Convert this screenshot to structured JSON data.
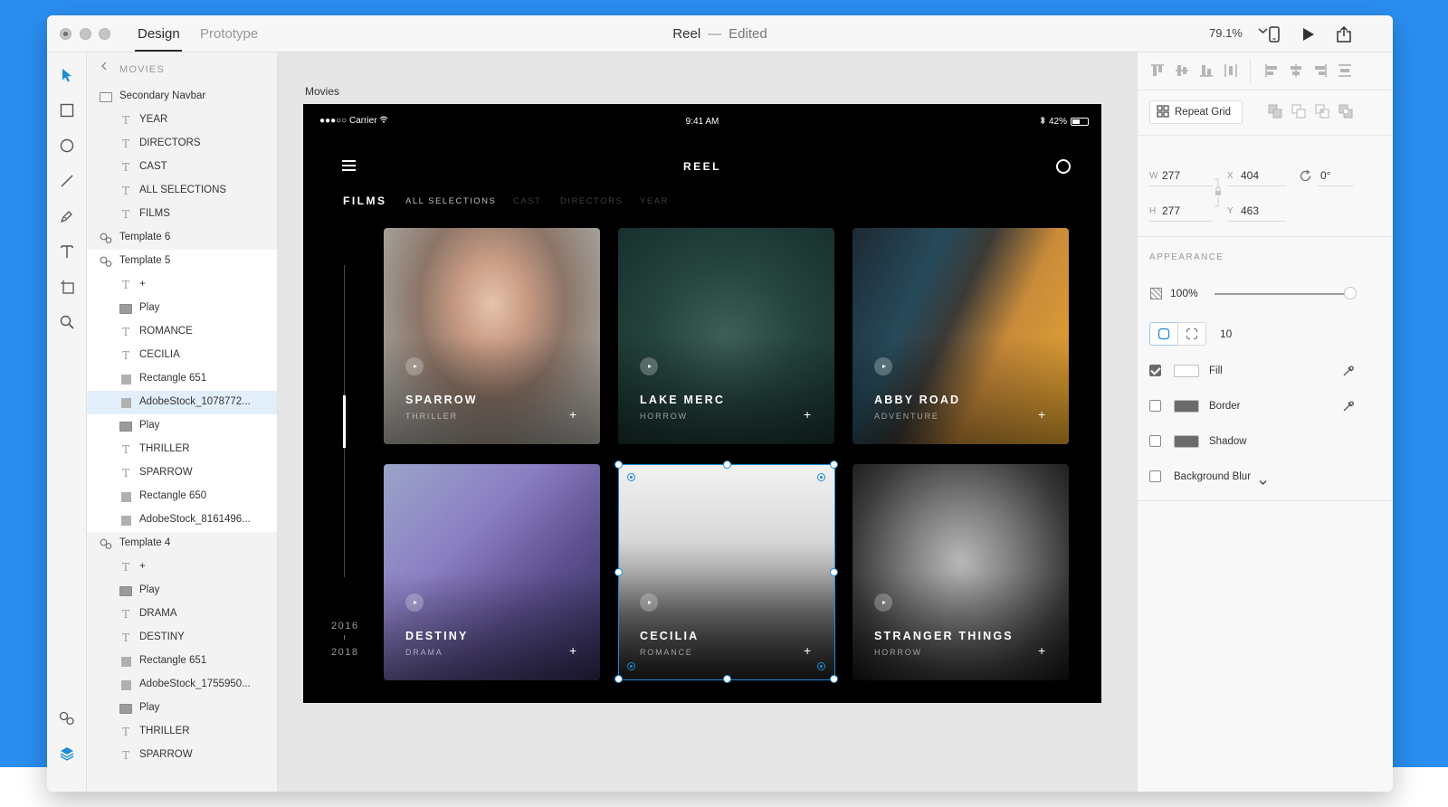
{
  "window": {
    "modes": [
      "Design",
      "Prototype"
    ],
    "active_mode": "Design",
    "doc_name": "Reel",
    "doc_separator": "—",
    "doc_status": "Edited",
    "zoom": "79.1%"
  },
  "toolbar": {
    "tools": [
      "select-arrow-icon",
      "rectangle-icon",
      "ellipse-icon",
      "line-icon",
      "pen-icon",
      "text-icon",
      "artboard-icon",
      "zoom-icon"
    ],
    "bottom_tools": [
      "symbols-icon",
      "layers-icon"
    ],
    "accent": "#1c8bd8"
  },
  "layers": {
    "title": "MOVIES",
    "items": [
      {
        "label": "Secondary Navbar",
        "type": "folder-outline",
        "indent": 0
      },
      {
        "label": "YEAR",
        "type": "text",
        "indent": 1
      },
      {
        "label": "DIRECTORS",
        "type": "text",
        "indent": 1
      },
      {
        "label": "CAST",
        "type": "text",
        "indent": 1
      },
      {
        "label": "ALL SELECTIONS",
        "type": "text",
        "indent": 1
      },
      {
        "label": "FILMS",
        "type": "text",
        "indent": 1
      },
      {
        "label": "Template 6",
        "type": "symbol",
        "indent": 0
      },
      {
        "label": "Template 5",
        "type": "symbol",
        "indent": 0
      },
      {
        "label": "+",
        "type": "text",
        "indent": 1
      },
      {
        "label": "Play",
        "type": "folder",
        "indent": 1
      },
      {
        "label": "ROMANCE",
        "type": "text",
        "indent": 1
      },
      {
        "label": "CECILIA",
        "type": "text",
        "indent": 1
      },
      {
        "label": "Rectangle 651",
        "type": "rect",
        "indent": 1
      },
      {
        "label": "AdobeStock_1078772...",
        "type": "rect",
        "indent": 1
      },
      {
        "label": "Play",
        "type": "folder",
        "indent": 1
      },
      {
        "label": "THRILLER",
        "type": "text",
        "indent": 1
      },
      {
        "label": "SPARROW",
        "type": "text",
        "indent": 1
      },
      {
        "label": "Rectangle 650",
        "type": "rect",
        "indent": 1
      },
      {
        "label": "AdobeStock_8161496...",
        "type": "rect",
        "indent": 1
      },
      {
        "label": "Template 4",
        "type": "symbol",
        "indent": 0
      },
      {
        "label": "+",
        "type": "text",
        "indent": 1
      },
      {
        "label": "Play",
        "type": "folder",
        "indent": 1
      },
      {
        "label": "DRAMA",
        "type": "text",
        "indent": 1
      },
      {
        "label": "DESTINY",
        "type": "text",
        "indent": 1
      },
      {
        "label": "Rectangle 651",
        "type": "rect",
        "indent": 1
      },
      {
        "label": "AdobeStock_1755950...",
        "type": "rect",
        "indent": 1
      },
      {
        "label": "Play",
        "type": "folder",
        "indent": 1
      },
      {
        "label": "THRILLER",
        "type": "text",
        "indent": 1
      },
      {
        "label": "SPARROW",
        "type": "text",
        "indent": 1
      }
    ],
    "selected_index": 13,
    "highlight_range": [
      7,
      18
    ]
  },
  "canvas": {
    "artboard_label": "Movies",
    "status": {
      "carrier": "●●●○○ Carrier",
      "time": "9:41 AM",
      "battery": "42%"
    },
    "app_title": "REEL",
    "nav": {
      "films": "FILMS",
      "items": [
        "ALL SELECTIONS",
        "CAST",
        "DIRECTORS",
        "YEAR"
      ],
      "active_item": "ALL SELECTIONS"
    },
    "years": {
      "from": "2016",
      "to": "2018"
    },
    "cards": [
      {
        "title": "SPARROW",
        "genre": "THRILLER",
        "plus": "+",
        "theme": "sparrow"
      },
      {
        "title": "LAKE MERC",
        "genre": "HORROW",
        "plus": "+",
        "theme": "lake"
      },
      {
        "title": "ABBY ROAD",
        "genre": "ADVENTURE",
        "plus": "+",
        "theme": "abby"
      },
      {
        "title": "DESTINY",
        "genre": "DRAMA",
        "plus": "+",
        "theme": "destiny"
      },
      {
        "title": "CECILIA",
        "genre": "ROMANCE",
        "plus": "+",
        "theme": "cecilia"
      },
      {
        "title": "STRANGER THINGS",
        "genre": "HORROW",
        "plus": "+",
        "theme": "stranger"
      }
    ]
  },
  "props": {
    "repeat_grid": "Repeat Grid",
    "w_label": "W",
    "w": "277",
    "h_label": "H",
    "h": "277",
    "x_label": "X",
    "x": "404",
    "y_label": "Y",
    "y": "463",
    "rotation": "0°",
    "appearance_title": "APPEARANCE",
    "opacity": "100%",
    "corner_radius": "10",
    "fill_label": "Fill",
    "fill_checked": true,
    "fill_color": "#ffffff",
    "border_label": "Border",
    "border_checked": false,
    "border_color": "#6b6b6b",
    "shadow_label": "Shadow",
    "shadow_checked": false,
    "shadow_color": "#6b6b6b",
    "blur_label": "Background Blur",
    "blur_checked": false
  }
}
